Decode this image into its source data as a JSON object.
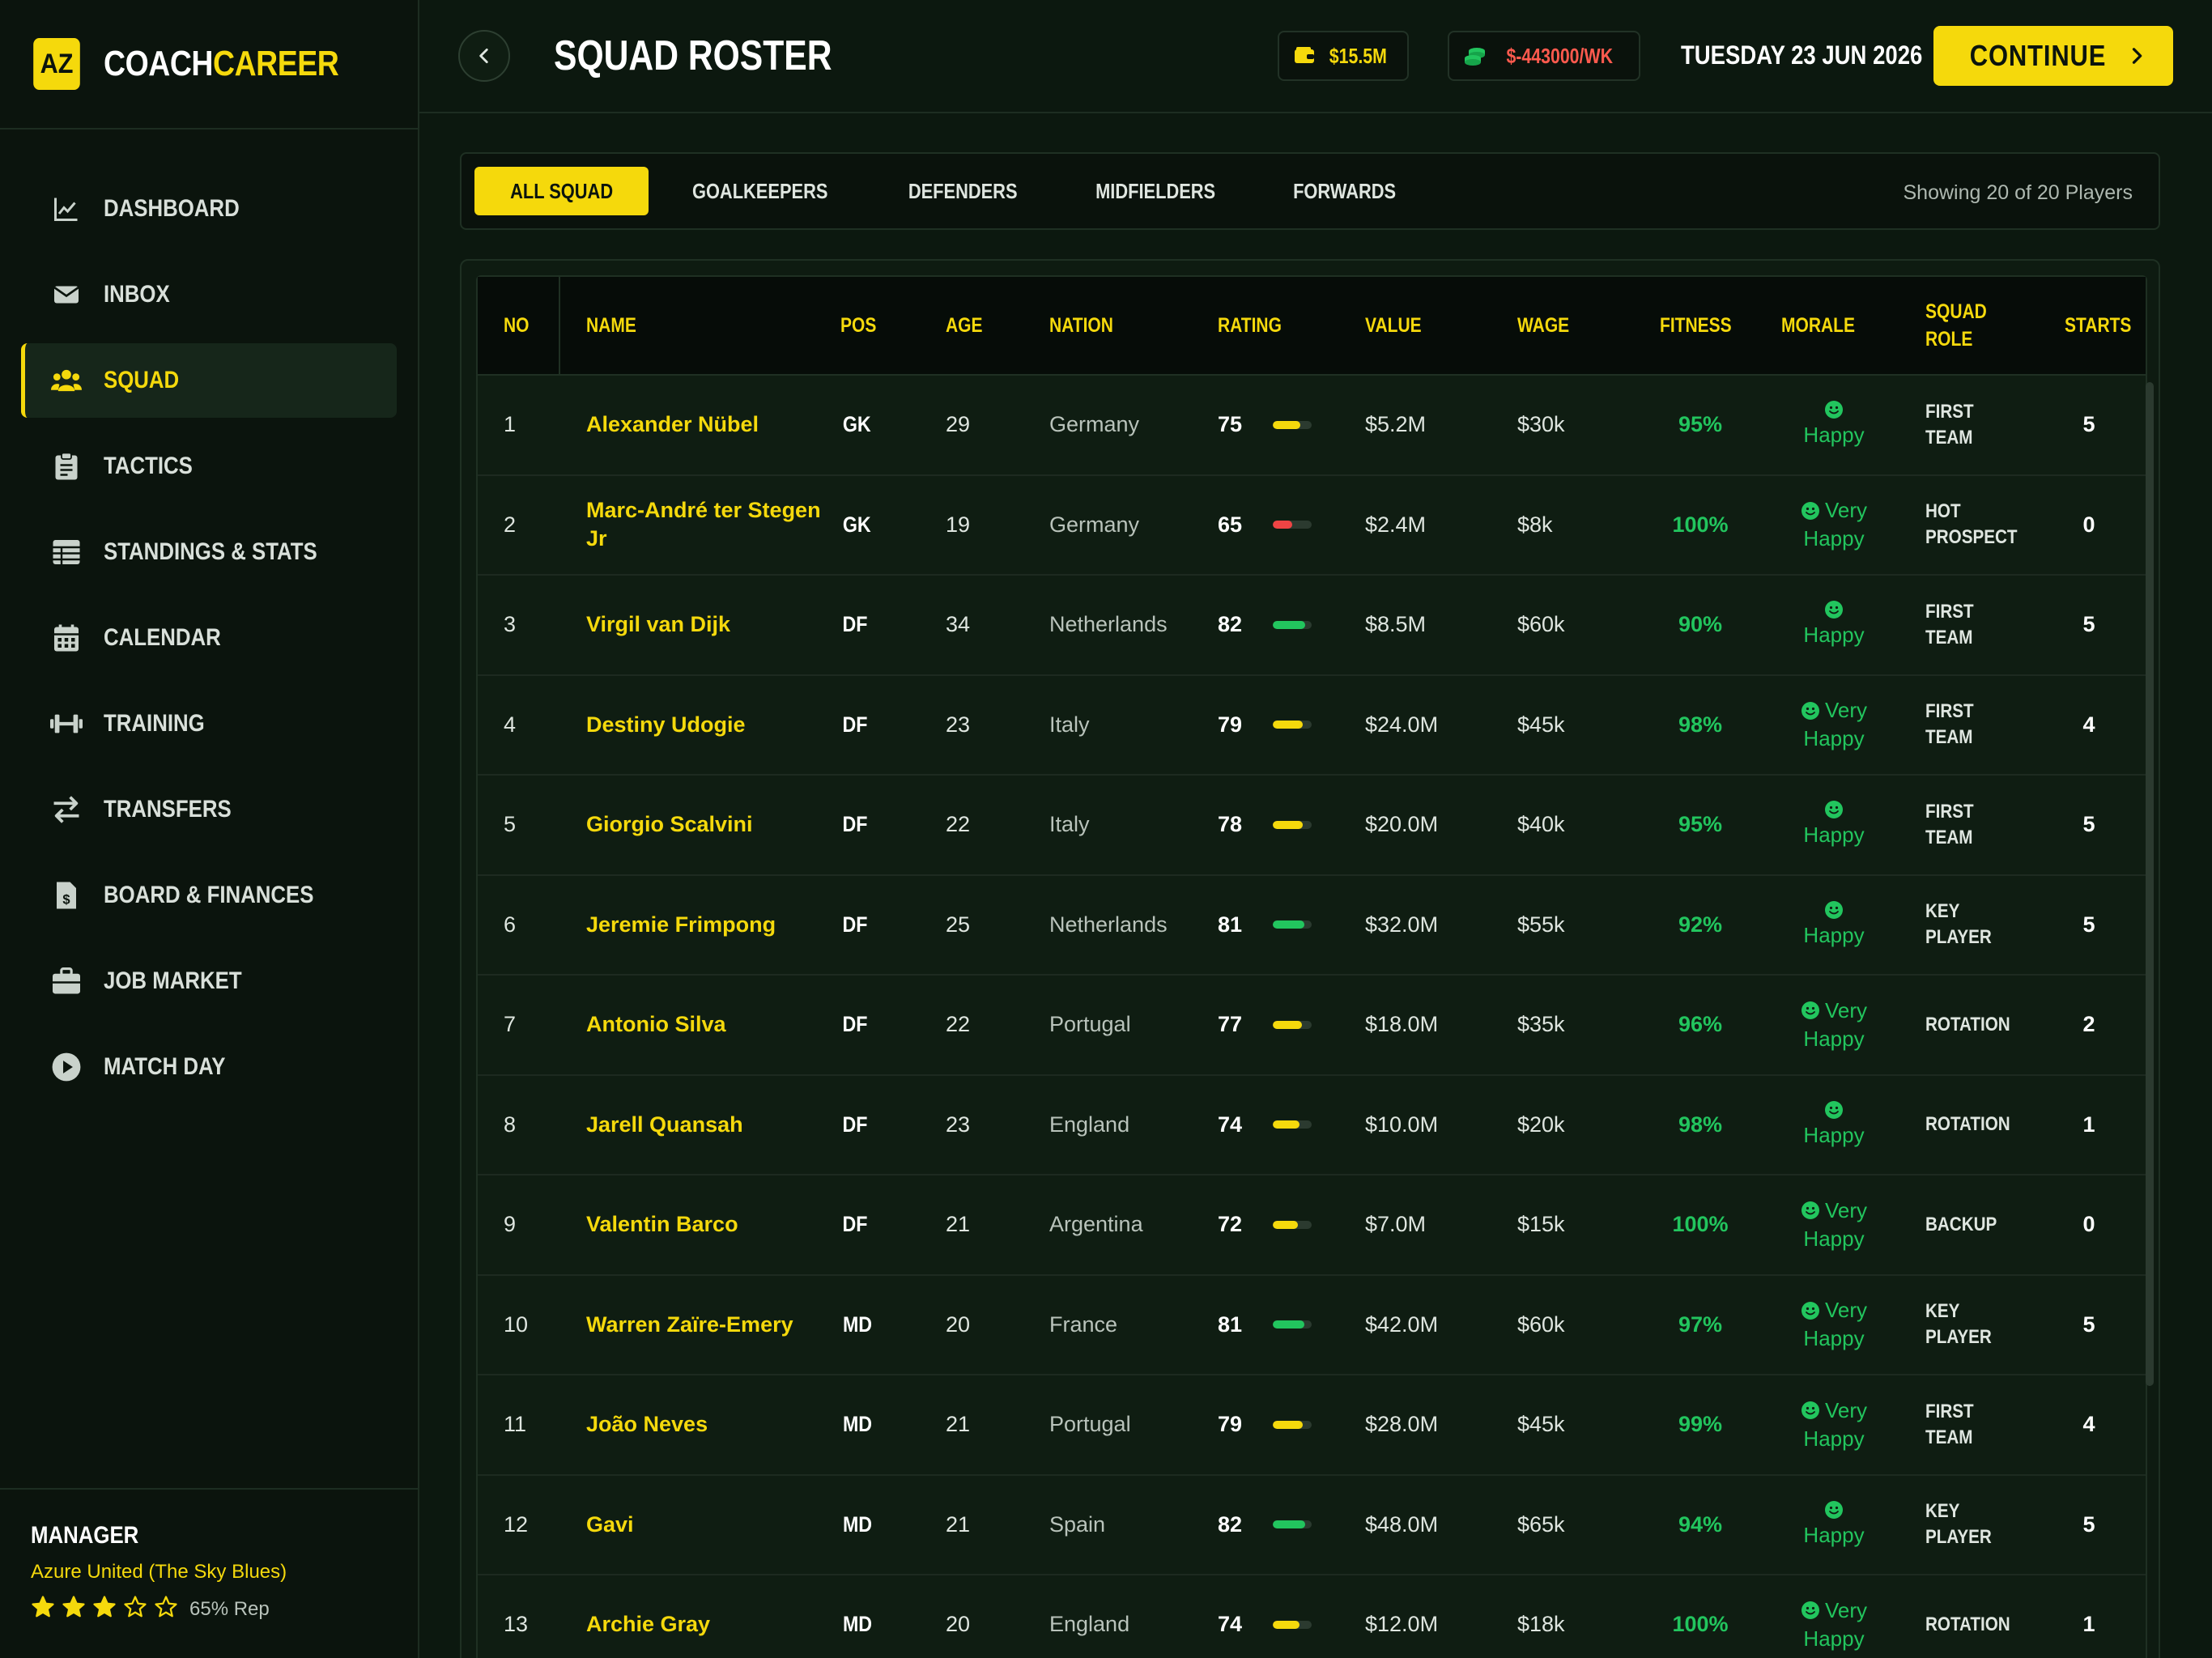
{
  "brand": {
    "badge": "AZ",
    "name_part1": "COACH",
    "name_part2": "CAREER"
  },
  "nav": [
    {
      "label": "DASHBOARD",
      "icon": "chart-line-icon",
      "active": false
    },
    {
      "label": "INBOX",
      "icon": "envelope-icon",
      "active": false
    },
    {
      "label": "SQUAD",
      "icon": "users-icon",
      "active": true
    },
    {
      "label": "TACTICS",
      "icon": "clipboard-icon",
      "active": false
    },
    {
      "label": "STANDINGS & STATS",
      "icon": "table-icon",
      "active": false
    },
    {
      "label": "CALENDAR",
      "icon": "calendar-icon",
      "active": false
    },
    {
      "label": "TRAINING",
      "icon": "dumbbell-icon",
      "active": false
    },
    {
      "label": "TRANSFERS",
      "icon": "transfer-arrows-icon",
      "active": false
    },
    {
      "label": "BOARD & FINANCES",
      "icon": "invoice-dollar-icon",
      "active": false
    },
    {
      "label": "JOB MARKET",
      "icon": "briefcase-icon",
      "active": false
    },
    {
      "label": "MATCH DAY",
      "icon": "play-circle-icon",
      "active": false
    }
  ],
  "manager": {
    "title": "MANAGER",
    "club": "Azure United (The Sky Blues)",
    "stars": 3,
    "max_stars": 5,
    "rep": "65% Rep"
  },
  "header": {
    "title": "SQUAD ROSTER",
    "budget": "$15.5M",
    "wage_balance": "$-443000/WK",
    "date": "TUESDAY 23 JUN 2026",
    "continue_label": "CONTINUE"
  },
  "filters": {
    "tabs": [
      "ALL SQUAD",
      "GOALKEEPERS",
      "DEFENDERS",
      "MIDFIELDERS",
      "FORWARDS"
    ],
    "active": 0,
    "showing": "Showing 20 of 20 Players"
  },
  "table": {
    "columns": [
      "NO",
      "NAME",
      "POS",
      "AGE",
      "NATION",
      "RATING",
      "VALUE",
      "WAGE",
      "FITNESS",
      "MORALE",
      "SQUAD ROLE",
      "STARTS"
    ],
    "rows": [
      {
        "no": "1",
        "name": "Alexander Nübel",
        "pos": "GK",
        "age": "29",
        "nation": "Germany",
        "rating": "75",
        "value": "$5.2M",
        "wage": "$30k",
        "fitness": "95%",
        "morale": "Happy",
        "role": "FIRST TEAM",
        "starts": "5"
      },
      {
        "no": "2",
        "name": "Marc-André ter Stegen Jr",
        "pos": "GK",
        "age": "19",
        "nation": "Germany",
        "rating": "65",
        "value": "$2.4M",
        "wage": "$8k",
        "fitness": "100%",
        "morale": "Very Happy",
        "role": "HOT PROSPECT",
        "starts": "0"
      },
      {
        "no": "3",
        "name": "Virgil van Dijk",
        "pos": "DF",
        "age": "34",
        "nation": "Netherlands",
        "rating": "82",
        "value": "$8.5M",
        "wage": "$60k",
        "fitness": "90%",
        "morale": "Happy",
        "role": "FIRST TEAM",
        "starts": "5"
      },
      {
        "no": "4",
        "name": "Destiny Udogie",
        "pos": "DF",
        "age": "23",
        "nation": "Italy",
        "rating": "79",
        "value": "$24.0M",
        "wage": "$45k",
        "fitness": "98%",
        "morale": "Very Happy",
        "role": "FIRST TEAM",
        "starts": "4"
      },
      {
        "no": "5",
        "name": "Giorgio Scalvini",
        "pos": "DF",
        "age": "22",
        "nation": "Italy",
        "rating": "78",
        "value": "$20.0M",
        "wage": "$40k",
        "fitness": "95%",
        "morale": "Happy",
        "role": "FIRST TEAM",
        "starts": "5"
      },
      {
        "no": "6",
        "name": "Jeremie Frimpong",
        "pos": "DF",
        "age": "25",
        "nation": "Netherlands",
        "rating": "81",
        "value": "$32.0M",
        "wage": "$55k",
        "fitness": "92%",
        "morale": "Happy",
        "role": "KEY PLAYER",
        "starts": "5"
      },
      {
        "no": "7",
        "name": "Antonio Silva",
        "pos": "DF",
        "age": "22",
        "nation": "Portugal",
        "rating": "77",
        "value": "$18.0M",
        "wage": "$35k",
        "fitness": "96%",
        "morale": "Very Happy",
        "role": "ROTATION",
        "starts": "2"
      },
      {
        "no": "8",
        "name": "Jarell Quansah",
        "pos": "DF",
        "age": "23",
        "nation": "England",
        "rating": "74",
        "value": "$10.0M",
        "wage": "$20k",
        "fitness": "98%",
        "morale": "Happy",
        "role": "ROTATION",
        "starts": "1"
      },
      {
        "no": "9",
        "name": "Valentin Barco",
        "pos": "DF",
        "age": "21",
        "nation": "Argentina",
        "rating": "72",
        "value": "$7.0M",
        "wage": "$15k",
        "fitness": "100%",
        "morale": "Very Happy",
        "role": "BACKUP",
        "starts": "0"
      },
      {
        "no": "10",
        "name": "Warren Zaïre-Emery",
        "pos": "MD",
        "age": "20",
        "nation": "France",
        "rating": "81",
        "value": "$42.0M",
        "wage": "$60k",
        "fitness": "97%",
        "morale": "Very Happy",
        "role": "KEY PLAYER",
        "starts": "5"
      },
      {
        "no": "11",
        "name": "João Neves",
        "pos": "MD",
        "age": "21",
        "nation": "Portugal",
        "rating": "79",
        "value": "$28.0M",
        "wage": "$45k",
        "fitness": "99%",
        "morale": "Very Happy",
        "role": "FIRST TEAM",
        "starts": "4"
      },
      {
        "no": "12",
        "name": "Gavi",
        "pos": "MD",
        "age": "21",
        "nation": "Spain",
        "rating": "82",
        "value": "$48.0M",
        "wage": "$65k",
        "fitness": "94%",
        "morale": "Happy",
        "role": "KEY PLAYER",
        "starts": "5"
      },
      {
        "no": "13",
        "name": "Archie Gray",
        "pos": "MD",
        "age": "20",
        "nation": "England",
        "rating": "74",
        "value": "$12.0M",
        "wage": "$18k",
        "fitness": "100%",
        "morale": "Very Happy",
        "role": "ROTATION",
        "starts": "1"
      }
    ]
  },
  "colors": {
    "accent": "#f5d90c",
    "positive": "#22c55e",
    "negative": "#ff5a4e",
    "rating_high": "#22c55e",
    "rating_mid": "#f5d90c",
    "rating_low": "#ef4444"
  }
}
